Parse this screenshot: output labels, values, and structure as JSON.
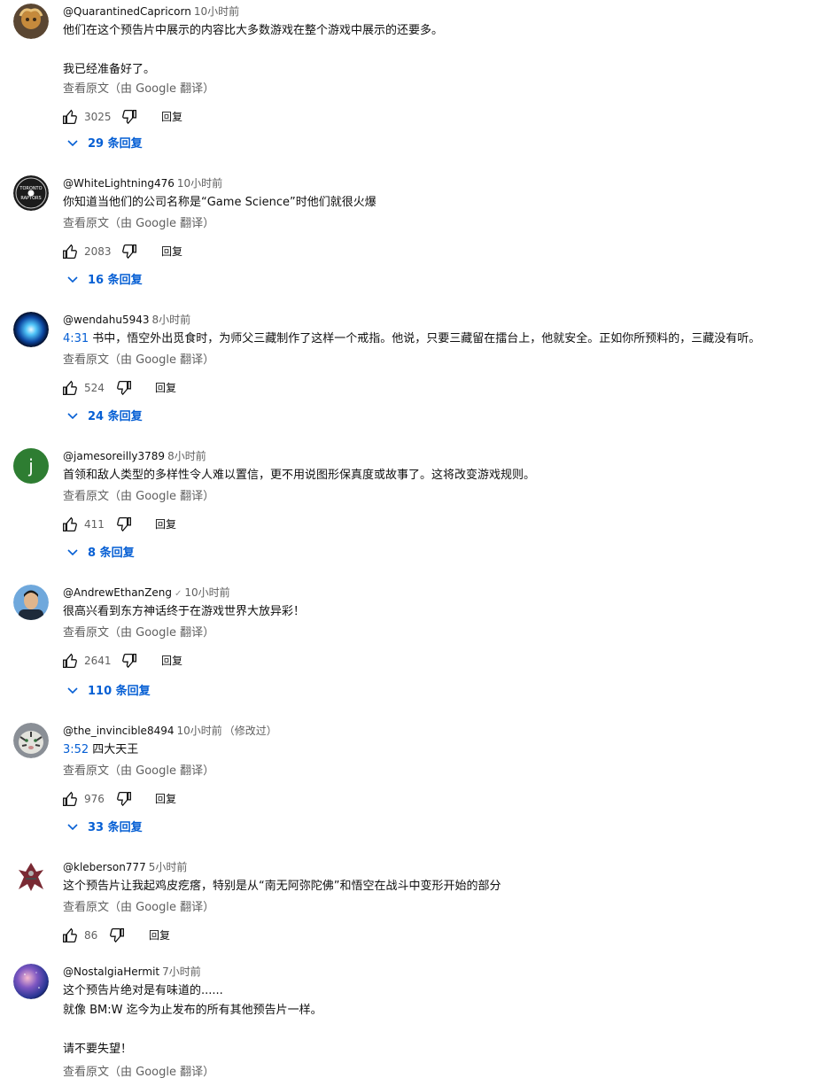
{
  "comments": [
    {
      "author": "@QuarantinedCapricorn",
      "time": "10小时前",
      "text": "他们在这个预告片中展示的内容比大多数游戏在整个游戏中展示的还要多。\n\n我已经准备好了。",
      "translate": "查看原文（由 Google 翻译）",
      "likes": "3025",
      "reply_label": "回复",
      "replies": "29 条回复",
      "avatar": "capricorn-avatar"
    },
    {
      "author": "@WhiteLightning476",
      "time": "10小时前",
      "text": "你知道当他们的公司名称是“Game Science”时他们就很火爆",
      "translate": "查看原文（由 Google 翻译）",
      "likes": "2083",
      "reply_label": "回复",
      "replies": "16 条回复",
      "avatar": "raptors-logo-avatar"
    },
    {
      "author": "@wendahu5943",
      "time": "8小时前",
      "timestamp": "4:31",
      "text": "书中，悟空外出觅食时，为师父三藏制作了这样一个戒指。他说，只要三藏留在擂台上，他就安全。正如你所预料的，三藏没有听。",
      "translate": "查看原文（由 Google 翻译）",
      "likes": "524",
      "reply_label": "回复",
      "replies": "24 条回复",
      "avatar": "blue-orb-avatar"
    },
    {
      "author": "@jamesoreilly3789",
      "time": "8小时前",
      "text": "首领和敌人类型的多样性令人难以置信，更不用说图形保真度或故事了。这将改变游戏规则。",
      "translate": "查看原文（由 Google 翻译）",
      "likes": "411",
      "reply_label": "回复",
      "replies": "8 条回复",
      "avatar_letter": "j",
      "avatar": "letter-avatar"
    },
    {
      "author": "@AndrewEthanZeng",
      "verified": "✓",
      "time": "10小时前",
      "text": "很高兴看到东方神话终于在游戏世界大放异彩！",
      "translate": "查看原文（由 Google 翻译）",
      "likes": "2641",
      "reply_label": "回复",
      "replies": "110 条回复",
      "avatar": "person-avatar"
    },
    {
      "author": "@the_invincible8494",
      "time": "10小时前",
      "edited": "（修改过）",
      "timestamp": "3:52",
      "text": "四大天王",
      "translate": "查看原文（由 Google 翻译）",
      "likes": "976",
      "reply_label": "回复",
      "replies": "33 条回复",
      "avatar": "tiger-avatar"
    },
    {
      "author": "@kleberson777",
      "time": "5小时前",
      "text": "这个预告片让我起鸡皮疙瘩，特别是从“南无阿弥陀佛”和悟空在战斗中变形开始的部分",
      "translate": "查看原文（由 Google 翻译）",
      "likes": "86",
      "reply_label": "回复",
      "avatar": "monster-avatar"
    },
    {
      "author": "@NostalgiaHermit",
      "time": "7小时前",
      "text": "这个预告片绝对是有味道的......\n就像 BM:W 迄今为止发布的所有其他预告片一样。\n\n请不要失望！",
      "translate": "查看原文（由 Google 翻译）",
      "avatar": "nebula-avatar"
    }
  ],
  "colors": {
    "link_blue": "#065fd4",
    "secondary_text": "#606060",
    "avatar_green": "#2e7d32"
  },
  "icons": [
    "thumb-up-icon",
    "thumb-down-icon",
    "chevron-down-icon",
    "verified-icon"
  ]
}
